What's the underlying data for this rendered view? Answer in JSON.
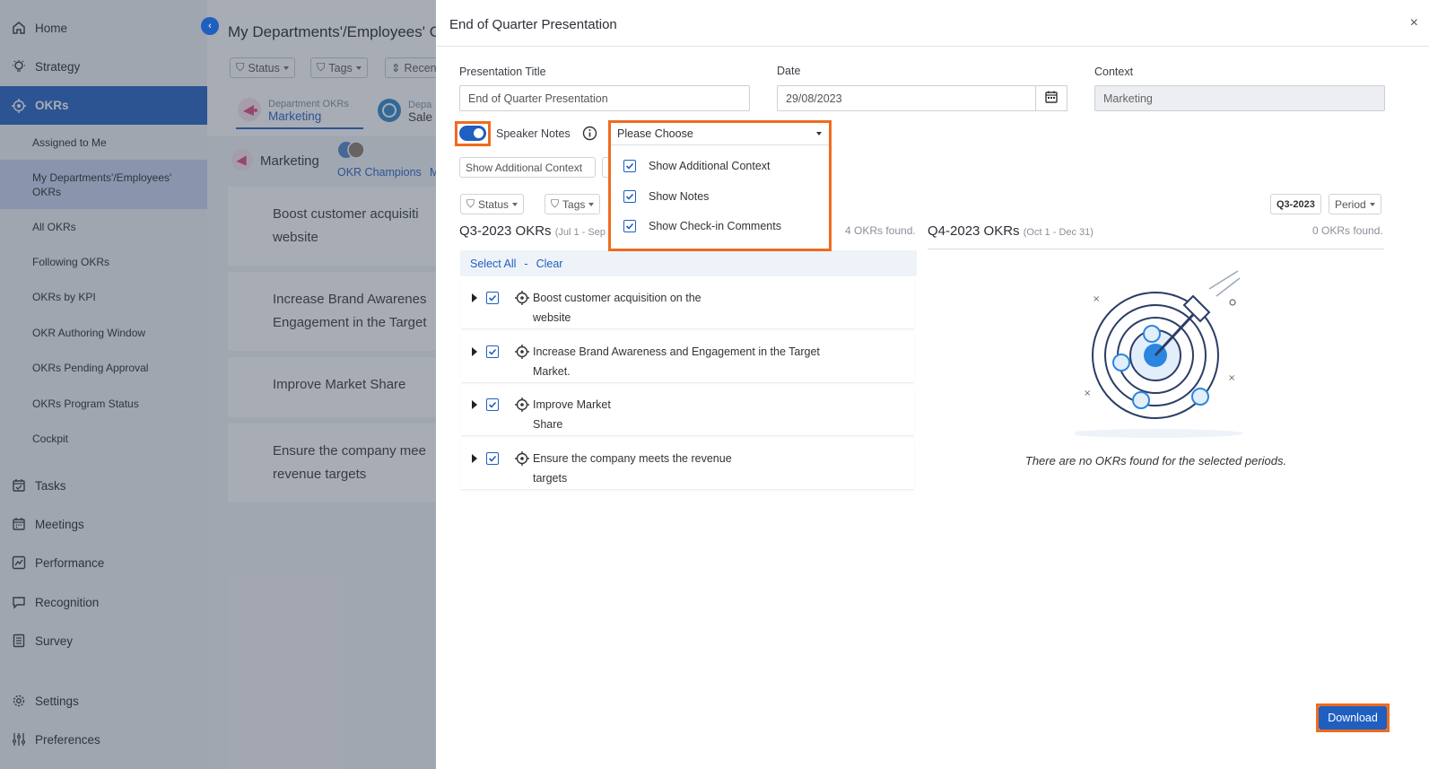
{
  "sidebar": {
    "items": [
      {
        "label": "Home"
      },
      {
        "label": "Strategy"
      },
      {
        "label": "OKRs"
      },
      {
        "label": "Tasks"
      },
      {
        "label": "Meetings"
      },
      {
        "label": "Performance"
      },
      {
        "label": "Recognition"
      },
      {
        "label": "Survey"
      },
      {
        "label": "Settings"
      },
      {
        "label": "Preferences"
      }
    ],
    "okr_sub": [
      {
        "label": "Assigned to Me"
      },
      {
        "label": "My Departments'/Employees' OKRs"
      },
      {
        "label": "All OKRs"
      },
      {
        "label": "Following OKRs"
      },
      {
        "label": "OKRs by KPI"
      },
      {
        "label": "OKR Authoring Window"
      },
      {
        "label": "OKRs Pending Approval"
      },
      {
        "label": "OKRs Program Status"
      },
      {
        "label": "Cockpit"
      }
    ]
  },
  "background": {
    "title": "My Departments'/Employees' O",
    "filters": {
      "status": "Status",
      "tags": "Tags",
      "recent": "Recen"
    },
    "tabs": [
      {
        "small": "Department OKRs",
        "main": "Marketing"
      },
      {
        "small": "Depa",
        "main": "Sale"
      }
    ],
    "dept_name": "Marketing",
    "okr_champions": "OKR Champions",
    "m_letter": "M",
    "cards": [
      "Boost customer acquisiti website",
      "Increase Brand Awarenes Engagement in the Target",
      "Improve Market Share",
      "Ensure the company mee revenue targets"
    ]
  },
  "panel": {
    "title": "End of Quarter Presentation",
    "close": "×",
    "presentation_title_label": "Presentation Title",
    "presentation_title_value": "End of Quarter Presentation",
    "date_label": "Date",
    "date_value": "29/08/2023",
    "context_label": "Context",
    "context_value": "Marketing",
    "speaker_notes_label": "Speaker Notes",
    "show_additional_context_btn": "Show Additional Context",
    "dropdown": {
      "selected": "Please Choose",
      "options": [
        {
          "label": "Show Additional Context",
          "checked": true
        },
        {
          "label": "Show Notes",
          "checked": true
        },
        {
          "label": "Show Check-in Comments",
          "checked": true
        }
      ]
    },
    "filters": {
      "status": "Status",
      "tags": "Tags"
    },
    "period_badge": "Q3-2023",
    "period_select": "Period",
    "left_section": {
      "title": "Q3-2023 OKRs",
      "range": "(Jul 1 - Sep",
      "count": "4 OKRs found."
    },
    "right_section": {
      "title": "Q4-2023 OKRs",
      "range": "(Oct 1 - Dec 31)",
      "count": "0 OKRs found."
    },
    "select_all": "Select All",
    "separator": "-",
    "clear": "Clear",
    "okrs": [
      {
        "text": "Boost customer acquisition on the website"
      },
      {
        "text": "Increase Brand Awareness and Engagement in the Target Market."
      },
      {
        "text": "Improve Market Share"
      },
      {
        "text": "Ensure the company meets the revenue targets"
      }
    ],
    "empty_message": "There are no OKRs found for the selected periods.",
    "download": "Download",
    "colors": {
      "accent": "#1f5fbf",
      "highlight": "#ef6b1f"
    }
  }
}
